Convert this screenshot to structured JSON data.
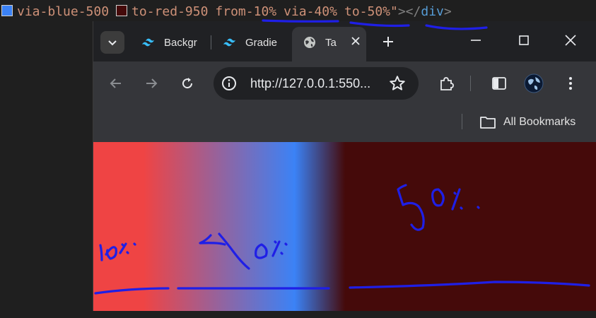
{
  "code": {
    "tokens": [
      {
        "text": "via-blue-500",
        "swatch": "#3b82f6"
      },
      {
        "text": "to-red-950",
        "swatch": "#450a0a"
      },
      {
        "text": "from-10%"
      },
      {
        "text": "via-40%"
      },
      {
        "text": "to-50%\""
      }
    ],
    "close_tag": "></",
    "tag_name": "div",
    "end": ">"
  },
  "tabs": [
    {
      "label": "Backgr",
      "icon": "tailwind-icon"
    },
    {
      "label": "Gradie",
      "icon": "tailwind-icon"
    },
    {
      "label": "Ta",
      "icon": "globe-icon",
      "active": true
    }
  ],
  "toolbar": {
    "url": "http://127.0.0.1:550..."
  },
  "bookmarks": {
    "all_label": "All Bookmarks"
  },
  "gradient": {
    "from": "#ef4444",
    "from_stop": "10%",
    "via": "#3b82f6",
    "via_stop": "40%",
    "to": "#450a0a",
    "to_stop": "50%"
  },
  "annotations": {
    "color": "#1f1fe6"
  }
}
